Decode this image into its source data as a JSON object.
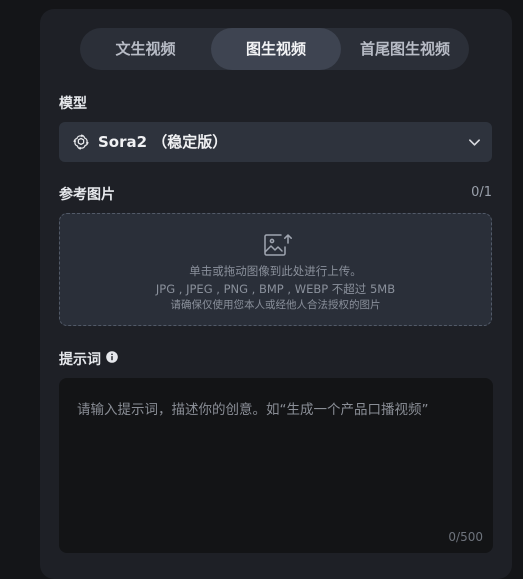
{
  "tabs": [
    {
      "label": "文生视频",
      "active": false
    },
    {
      "label": "图生视频",
      "active": true
    },
    {
      "label": "首尾图生视频",
      "active": false
    }
  ],
  "model": {
    "label": "模型",
    "selected": "Sora2 （稳定版）",
    "logo_icon": "openai-logo-icon",
    "dropdown_icon": "chevron-down-icon"
  },
  "reference": {
    "label": "参考图片",
    "count": "0/1",
    "upload_icon": "image-upload-icon",
    "hint_line1": "单击或拖动图像到此处进行上传。",
    "hint_line2": "JPG , JPEG , PNG , BMP , WEBP 不超过 5MB",
    "hint_line3": "请确保仅使用您本人或经他人合法授权的图片"
  },
  "prompt": {
    "label": "提示词",
    "info_icon": "info-icon",
    "placeholder": "请输入提示词，描述你的创意。如“生成一个产品口播视频”",
    "value": "",
    "counter": "0/500"
  },
  "colors": {
    "page_bg": "#141518",
    "panel_bg": "#1e2026",
    "tab_active_bg": "#3e4451",
    "field_bg": "#2e333d",
    "prompt_bg": "#131416"
  }
}
